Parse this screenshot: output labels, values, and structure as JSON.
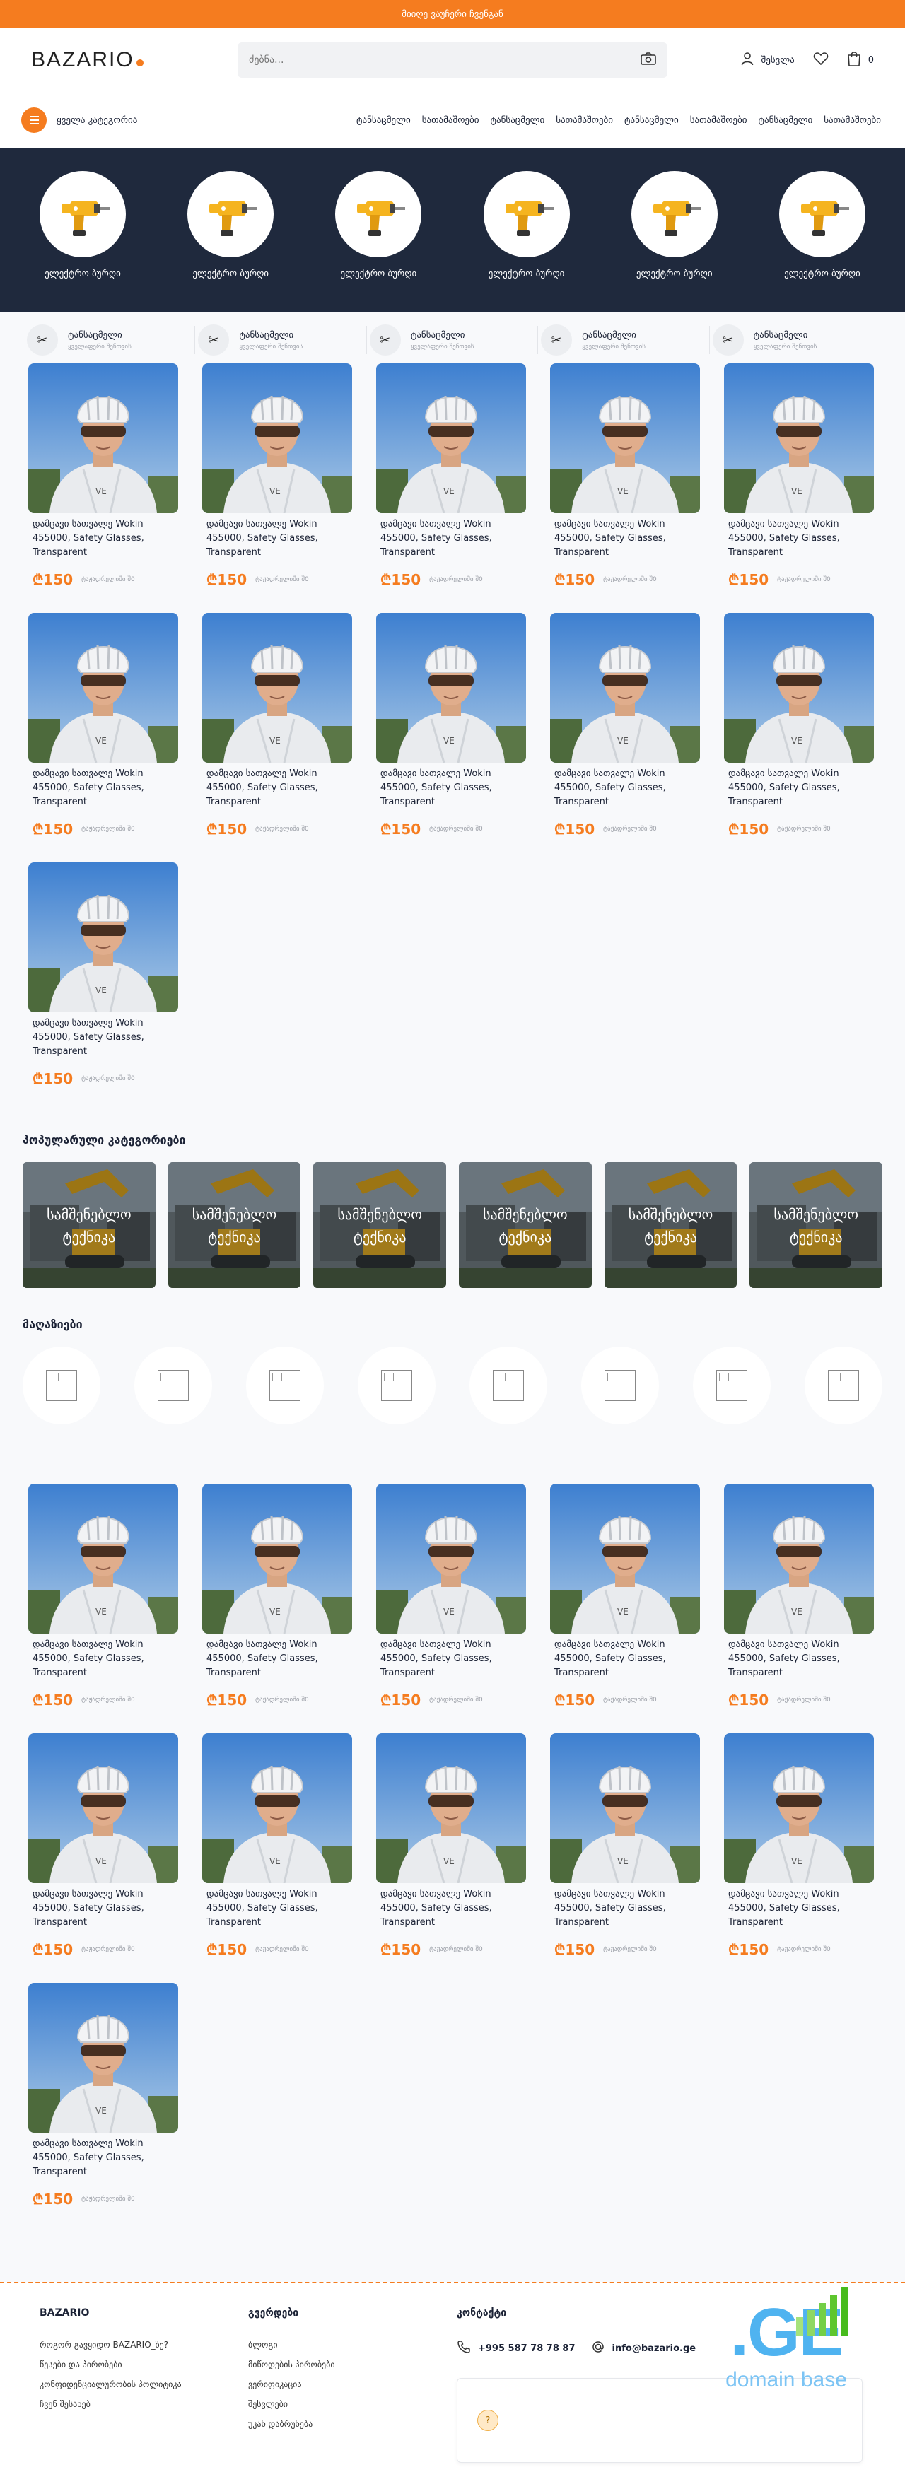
{
  "topbar": {
    "text": "მიიღე ვაუჩერი ჩვენგან"
  },
  "header": {
    "logo_text": "BAZARIO",
    "search_placeholder": "ძებნა...",
    "login_label": "შესვლა",
    "cart_count": "0"
  },
  "catbar": {
    "all_label": "ყველა კატეგორია",
    "links": [
      "ტანსაცმელი",
      "სათამაშოები",
      "ტანსაცმელი",
      "სათამაშოები",
      "ტანსაცმელი",
      "სათამაშოები",
      "ტანსაცმელი",
      "სათამაშოები"
    ]
  },
  "hero": {
    "items": [
      "ელექტრო ბურღი",
      "ელექტრო ბურღი",
      "ელექტრო ბურღი",
      "ელექტრო ბურღი",
      "ელექტრო ბურღი",
      "ელექტრო ბურღი"
    ]
  },
  "features": [
    {
      "title": "ტანსაცმელი",
      "sub": "ყველაფერი შენთვის"
    },
    {
      "title": "ტანსაცმელი",
      "sub": "ყველაფერი შენთვის"
    },
    {
      "title": "ტანსაცმელი",
      "sub": "ყველაფერი შენთვის"
    },
    {
      "title": "ტანსაცმელი",
      "sub": "ყველაფერი შენთვის"
    },
    {
      "title": "ტანსაცმელი",
      "sub": "ყველაფერი შენთვის"
    }
  ],
  "product": {
    "name": "დამცავი სათვალე Wokin 455000, Safety Glasses, Transparent",
    "price": "₾150",
    "shipping": "ტაჟადრელიში შ0"
  },
  "grid1": {
    "count": 11
  },
  "grid2": {
    "count": 11
  },
  "popular": {
    "title": "პოპულარული კატეგორიები",
    "items": [
      "სამშენებლო ტექნიკა",
      "სამშენებლო ტექნიკა",
      "სამშენებლო ტექნიკა",
      "სამშენებლო ტექნიკა",
      "სამშენებლო ტექნიკა",
      "სამშენებლო ტექნიკა"
    ]
  },
  "stores": {
    "title": "მაღაზიები",
    "count": 8
  },
  "footer": {
    "col1": {
      "title": "BAZARIO",
      "links": [
        "როგორ გავყიდო BAZARIO_ზე?",
        "წესები და პირობები",
        "კონფიდენციალურობის პოლიტიკა",
        "ჩვენ შესახებ"
      ]
    },
    "col2": {
      "title": "გვერდები",
      "links": [
        "ბლოგი",
        "მიწოდების პირობები",
        "ვერიფიკაცია",
        "შესვლები",
        "უკან დაბრუნება"
      ]
    },
    "col3": {
      "title": "კონტაქტი",
      "phone": "+995 587 78 78 87",
      "email": "info@bazario.ge"
    },
    "badge_ge": ".GE",
    "badge_domain": "domain base"
  },
  "colors": {
    "accent": "#f57c1f",
    "hero_bg": "#1f293d",
    "price": "#f57c1f"
  }
}
